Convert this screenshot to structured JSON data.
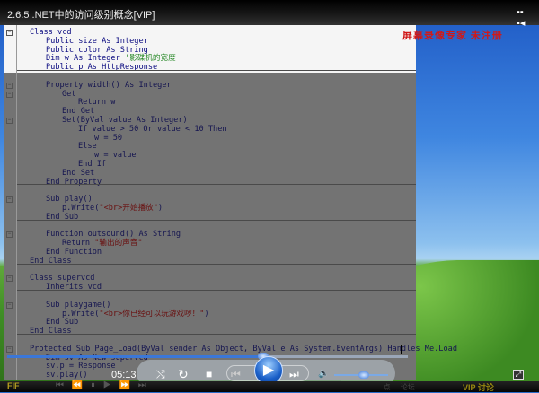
{
  "window": {
    "title": "2.6.5 .NET中的访问级别概念[VIP]",
    "menu_icon": "grid-menu-icon"
  },
  "watermark": "屏幕录像专家 未注册",
  "code": {
    "lines": [
      {
        "indent": 0,
        "segs": [
          {
            "t": "Class vcd"
          }
        ]
      },
      {
        "indent": 1,
        "segs": [
          {
            "t": "Public size As Integer"
          }
        ]
      },
      {
        "indent": 1,
        "segs": [
          {
            "t": "Public color As String"
          }
        ]
      },
      {
        "indent": 1,
        "segs": [
          {
            "t": "Dim w As Integer "
          },
          {
            "t": "'影碟机的宽度",
            "c": "cmt"
          }
        ]
      },
      {
        "indent": 1,
        "segs": [
          {
            "t": "Public p As HttpResponse"
          }
        ]
      },
      {
        "indent": 0,
        "segs": []
      },
      {
        "indent": 1,
        "segs": [
          {
            "t": "Property width() As Integer"
          }
        ]
      },
      {
        "indent": 2,
        "segs": [
          {
            "t": "Get"
          }
        ]
      },
      {
        "indent": 3,
        "segs": [
          {
            "t": "Return w"
          }
        ]
      },
      {
        "indent": 2,
        "segs": [
          {
            "t": "End Get"
          }
        ]
      },
      {
        "indent": 2,
        "segs": [
          {
            "t": "Set(ByVal value As Integer)"
          }
        ]
      },
      {
        "indent": 3,
        "segs": [
          {
            "t": "If value > 50 Or value < 10 Then"
          }
        ]
      },
      {
        "indent": 4,
        "segs": [
          {
            "t": "w = 50"
          }
        ]
      },
      {
        "indent": 3,
        "segs": [
          {
            "t": "Else"
          }
        ]
      },
      {
        "indent": 4,
        "segs": [
          {
            "t": "w = value"
          }
        ]
      },
      {
        "indent": 3,
        "segs": [
          {
            "t": "End If"
          }
        ]
      },
      {
        "indent": 2,
        "segs": [
          {
            "t": "End Set"
          }
        ]
      },
      {
        "indent": 1,
        "segs": [
          {
            "t": "End Property"
          }
        ]
      },
      {
        "indent": 0,
        "segs": []
      },
      {
        "indent": 1,
        "segs": [
          {
            "t": "Sub play()"
          }
        ]
      },
      {
        "indent": 2,
        "segs": [
          {
            "t": "p.Write("
          },
          {
            "t": "\"<br>开始播放\"",
            "c": "str"
          },
          {
            "t": ")"
          }
        ]
      },
      {
        "indent": 1,
        "segs": [
          {
            "t": "End Sub"
          }
        ]
      },
      {
        "indent": 0,
        "segs": []
      },
      {
        "indent": 1,
        "segs": [
          {
            "t": "Function outsound() As String"
          }
        ]
      },
      {
        "indent": 2,
        "segs": [
          {
            "t": "Return "
          },
          {
            "t": "\"输出的声音\"",
            "c": "str"
          }
        ]
      },
      {
        "indent": 1,
        "segs": [
          {
            "t": "End Function"
          }
        ]
      },
      {
        "indent": 0,
        "segs": [
          {
            "t": "End Class"
          }
        ]
      },
      {
        "indent": 0,
        "segs": []
      },
      {
        "indent": 0,
        "segs": [
          {
            "t": "Class supervcd"
          }
        ]
      },
      {
        "indent": 1,
        "segs": [
          {
            "t": "Inherits vcd"
          }
        ]
      },
      {
        "indent": 0,
        "segs": []
      },
      {
        "indent": 1,
        "segs": [
          {
            "t": "Sub playgame()"
          }
        ]
      },
      {
        "indent": 2,
        "segs": [
          {
            "t": "p.Write("
          },
          {
            "t": "\"<br>你已经可以玩游戏啰！\"",
            "c": "str"
          },
          {
            "t": ")"
          }
        ]
      },
      {
        "indent": 1,
        "segs": [
          {
            "t": "End Sub"
          }
        ]
      },
      {
        "indent": 0,
        "segs": [
          {
            "t": "End Class"
          }
        ]
      },
      {
        "indent": 0,
        "segs": []
      },
      {
        "indent": 0,
        "segs": [
          {
            "t": "Protected Sub Page_Load(ByVal sender As Object, ByVal e As System.EventArgs) Handles Me.Load"
          }
        ]
      },
      {
        "indent": 1,
        "segs": [
          {
            "t": "Dim sv As New supervcd"
          }
        ]
      },
      {
        "indent": 1,
        "segs": [
          {
            "t": "sv.p = Response"
          }
        ]
      },
      {
        "indent": 1,
        "segs": [
          {
            "t": "sv.play()"
          }
        ]
      }
    ]
  },
  "player": {
    "time": "05:13",
    "progress_percent": 64,
    "volume_percent": 55,
    "icons": {
      "shuffle": "⤭",
      "repeat": "↻",
      "stop": "■",
      "prev": "⏮",
      "play": "▶",
      "next": "⏭",
      "volume": "🔈",
      "expand": "⤢"
    }
  },
  "bottombar": {
    "logo": "FIF",
    "buttons": "⏮ ⏪ ⏸ ▶ ⏩ ⏭",
    "links": "...点 ... 论坛",
    "vip": "VIP 讨论"
  }
}
